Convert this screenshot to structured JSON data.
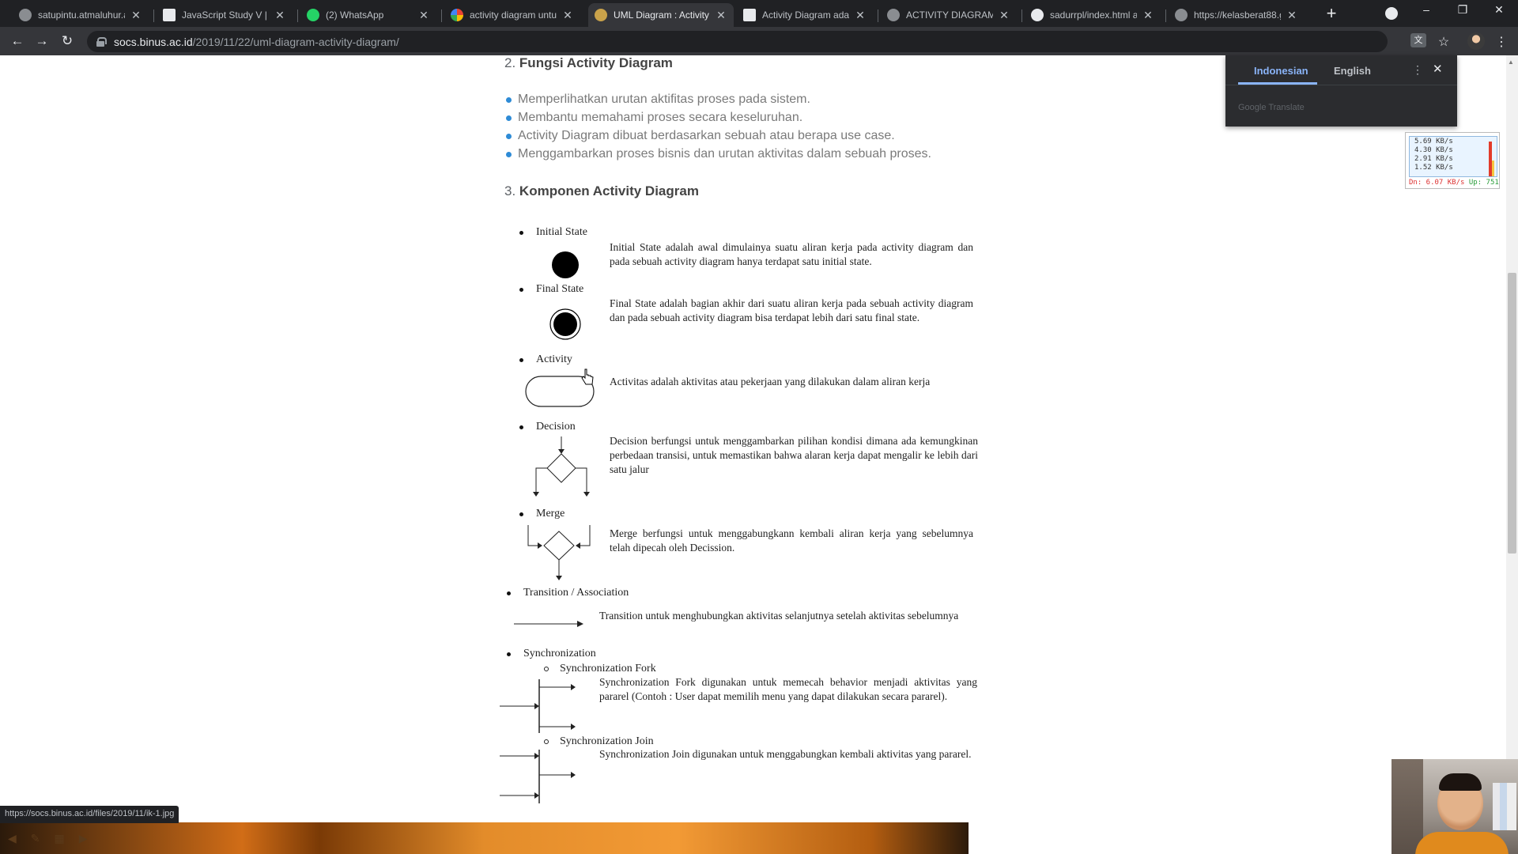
{
  "browser": {
    "tabs": [
      {
        "title": "satupintu.atmaluhur.ac",
        "active": false,
        "icon": "globe-icon"
      },
      {
        "title": "JavaScript Study V | Pa",
        "active": false,
        "icon": "page-icon"
      },
      {
        "title": "(2) WhatsApp",
        "active": false,
        "icon": "whatsapp-icon"
      },
      {
        "title": "activity diagram untuk",
        "active": false,
        "icon": "google-icon"
      },
      {
        "title": "UML Diagram : Activity",
        "active": true,
        "icon": "site-icon"
      },
      {
        "title": "Activity Diagram adal",
        "active": false,
        "icon": "mail-icon"
      },
      {
        "title": "ACTIVITY DIAGRAM",
        "active": false,
        "icon": "globe-icon"
      },
      {
        "title": "sadurrpl/index.html at",
        "active": false,
        "icon": "github-icon"
      },
      {
        "title": "https://kelasberat88.g",
        "active": false,
        "icon": "globe-icon"
      }
    ],
    "close_glyph": "✕",
    "newtab_glyph": "+",
    "url_host": "socs.binus.ac.id",
    "url_path": "/2019/11/22/uml-diagram-activity-diagram/",
    "status_url": "https://socs.binus.ac.id/files/2019/11/ik-1.jpg",
    "nav_glyphs": {
      "back": "←",
      "forward": "→",
      "reload": "↻",
      "star": "☆",
      "menu": "⋮",
      "minimize": "–",
      "restore": "❐",
      "close": "✕"
    },
    "colors": {
      "tabstrip": "#202124",
      "toolbar": "#35363a",
      "accent": "#8ab4f8"
    }
  },
  "translate_popup": {
    "source_lang": "Indonesian",
    "target_lang": "English",
    "brand": "Google Translate",
    "menu_glyph": "⋮",
    "close_glyph": "✕"
  },
  "netmeter": {
    "rates": [
      "5.69 KB/s",
      "4.30 KB/s",
      "2.91 KB/s",
      "1.52 KB/s"
    ],
    "down": "Dn: 6.07 KB/s",
    "up": "Up: 751"
  },
  "article": {
    "section2": {
      "num": "2.",
      "title": "Fungsi Activity Diagram"
    },
    "bullets": [
      "Memperlihatkan urutan aktifitas proses pada sistem.",
      "Membantu memahami proses secara keseluruhan.",
      "Activity Diagram dibuat berdasarkan sebuah atau berapa use case.",
      "Menggambarkan proses bisnis dan urutan aktivitas dalam sebuah proses."
    ],
    "section3": {
      "num": "3.",
      "title": "Komponen Activity Diagram"
    }
  },
  "components": {
    "initial": {
      "label": "Initial State",
      "desc": "Initial State adalah awal dimulainya suatu aliran kerja pada activity diagram dan pada sebuah activity diagram hanya terdapat satu initial state."
    },
    "final": {
      "label": "Final State",
      "desc": "Final State adalah bagian akhir dari suatu aliran kerja pada sebuah activity diagram dan pada sebuah activity diagram bisa terdapat lebih dari satu final state."
    },
    "activity": {
      "label": "Activity",
      "desc": "Activitas adalah aktivitas atau pekerjaan yang dilakukan dalam aliran kerja"
    },
    "decision": {
      "label": "Decision",
      "desc": "Decision berfungsi untuk menggambarkan pilihan kondisi dimana ada kemungkinan perbedaan transisi, untuk memastikan bahwa alaran kerja dapat mengalir ke lebih dari satu jalur"
    },
    "merge": {
      "label": "Merge",
      "desc": "Merge berfungsi untuk menggabungkann kembali aliran kerja yang sebelumnya telah dipecah oleh Decission."
    },
    "transition": {
      "label": "Transition / Association",
      "desc": "Transition untuk menghubungkan aktivitas selanjutnya setelah aktivitas sebelumnya"
    },
    "sync": {
      "label": "Synchronization"
    },
    "fork": {
      "label": "Synchronization Fork",
      "desc": "Synchronization Fork digunakan untuk memecah behavior menjadi aktivitas yang pararel (Contoh : User dapat memilih menu yang dapat dilakukan secara pararel)."
    },
    "join": {
      "label": "Synchronization Join",
      "desc": "Synchronization Join digunakan untuk menggabungkan kembali aktivitas yang pararel."
    }
  }
}
